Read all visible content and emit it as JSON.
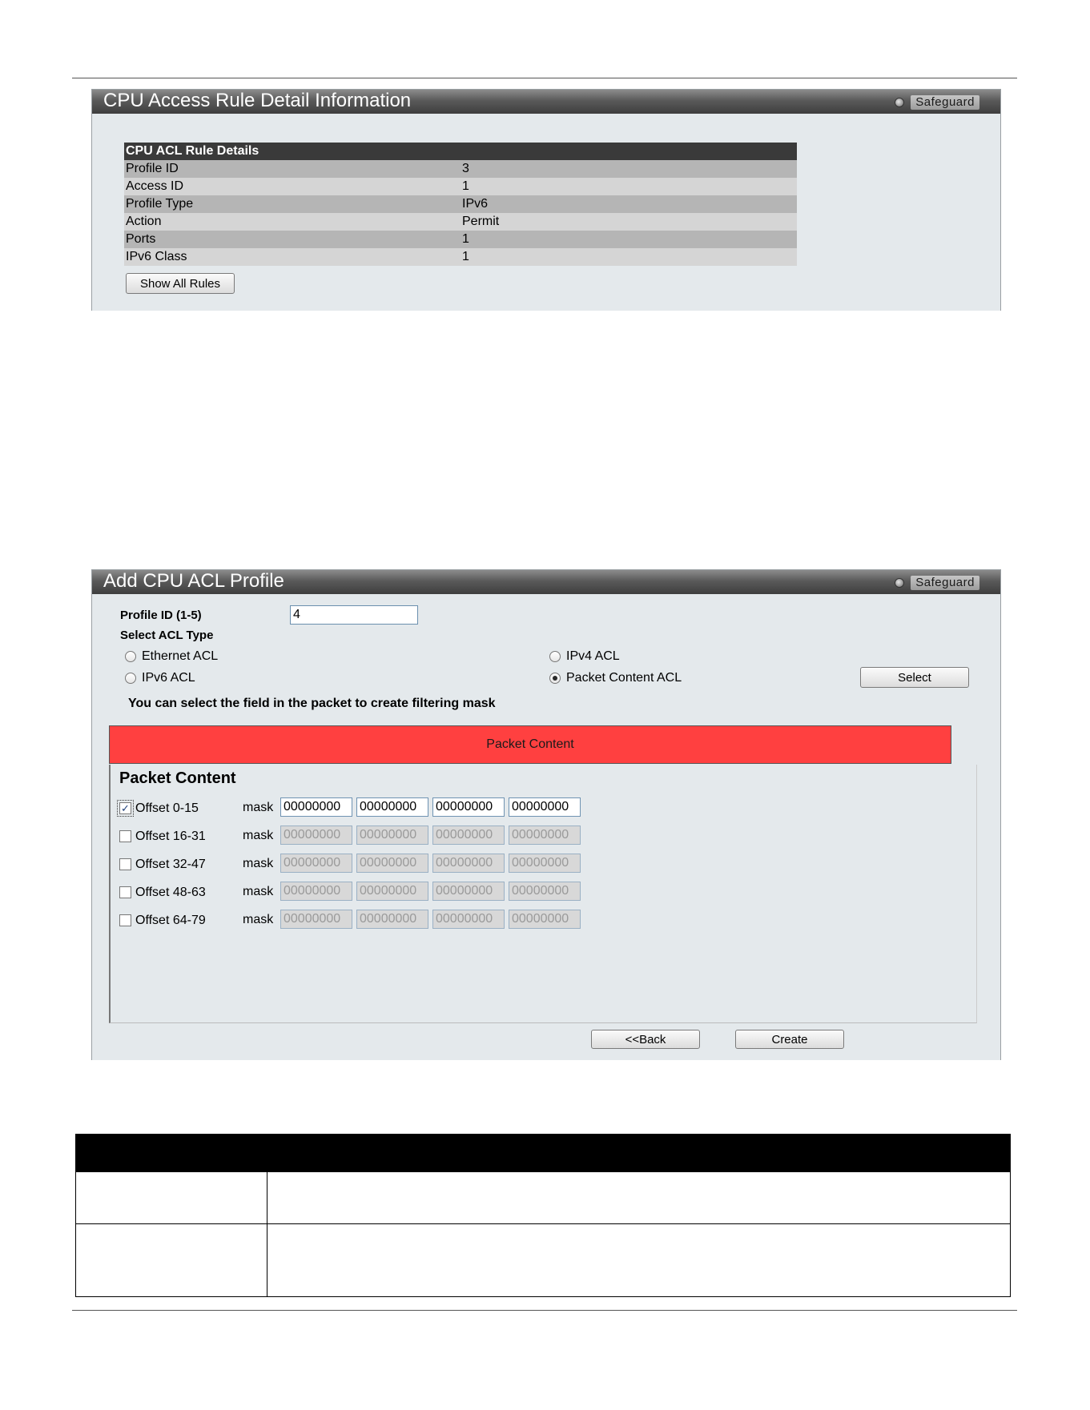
{
  "panel1": {
    "title": "CPU Access Rule Detail Information",
    "safeguard": "Safeguard",
    "table_header": "CPU ACL Rule Details",
    "rows": [
      {
        "label": "Profile ID",
        "value": "3"
      },
      {
        "label": "Access ID",
        "value": "1"
      },
      {
        "label": "Profile Type",
        "value": "IPv6"
      },
      {
        "label": "Action",
        "value": "Permit"
      },
      {
        "label": "Ports",
        "value": "1"
      },
      {
        "label": "IPv6 Class",
        "value": "1"
      }
    ],
    "show_all_button": "Show All Rules"
  },
  "panel2": {
    "title": "Add CPU ACL Profile",
    "safeguard": "Safeguard",
    "profile_id_label": "Profile ID (1-5)",
    "profile_id_value": "4",
    "select_acl_label": "Select ACL Type",
    "acl_types": [
      {
        "label": "Ethernet ACL",
        "selected": false
      },
      {
        "label": "IPv4 ACL",
        "selected": false
      },
      {
        "label": "IPv6 ACL",
        "selected": false
      },
      {
        "label": "Packet Content ACL",
        "selected": true
      }
    ],
    "select_button": "Select",
    "hint": "You can select the field in the packet to create filtering mask",
    "tab_label": "Packet Content",
    "section_title": "Packet Content",
    "mask_label": "mask",
    "offsets": [
      {
        "label": "Offset 0-15",
        "checked": true,
        "masks": [
          "00000000",
          "00000000",
          "00000000",
          "00000000"
        ]
      },
      {
        "label": "Offset 16-31",
        "checked": false,
        "masks": [
          "00000000",
          "00000000",
          "00000000",
          "00000000"
        ]
      },
      {
        "label": "Offset 32-47",
        "checked": false,
        "masks": [
          "00000000",
          "00000000",
          "00000000",
          "00000000"
        ]
      },
      {
        "label": "Offset 48-63",
        "checked": false,
        "masks": [
          "00000000",
          "00000000",
          "00000000",
          "00000000"
        ]
      },
      {
        "label": "Offset 64-79",
        "checked": false,
        "masks": [
          "00000000",
          "00000000",
          "00000000",
          "00000000"
        ]
      }
    ],
    "back_button": "<<Back",
    "create_button": "Create"
  }
}
